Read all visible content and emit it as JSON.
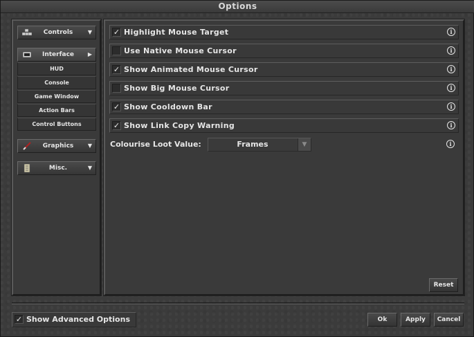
{
  "window": {
    "title": "Options"
  },
  "sidebar": {
    "controls": {
      "label": "Controls",
      "icon": "keyboard-icon"
    },
    "interface": {
      "label": "Interface",
      "icon": "monitor-icon",
      "subitems": [
        "HUD",
        "Console",
        "Game Window",
        "Action Bars",
        "Control Buttons"
      ]
    },
    "graphics": {
      "label": "Graphics",
      "icon": "brush-icon"
    },
    "misc": {
      "label": "Misc.",
      "icon": "scroll-icon"
    }
  },
  "options": [
    {
      "label": "Highlight Mouse Target",
      "checked": true
    },
    {
      "label": "Use Native Mouse Cursor",
      "checked": false
    },
    {
      "label": "Show Animated Mouse Cursor",
      "checked": true
    },
    {
      "label": "Show Big Mouse Cursor",
      "checked": false
    },
    {
      "label": "Show Cooldown Bar",
      "checked": true
    },
    {
      "label": "Show Link Copy Warning",
      "checked": true
    }
  ],
  "loot": {
    "label": "Colourise Loot Value:",
    "value": "Frames"
  },
  "buttons": {
    "reset": "Reset",
    "ok": "Ok",
    "apply": "Apply",
    "cancel": "Cancel"
  },
  "advanced": {
    "label": "Show Advanced Options",
    "checked": true
  },
  "info_glyph": "i"
}
